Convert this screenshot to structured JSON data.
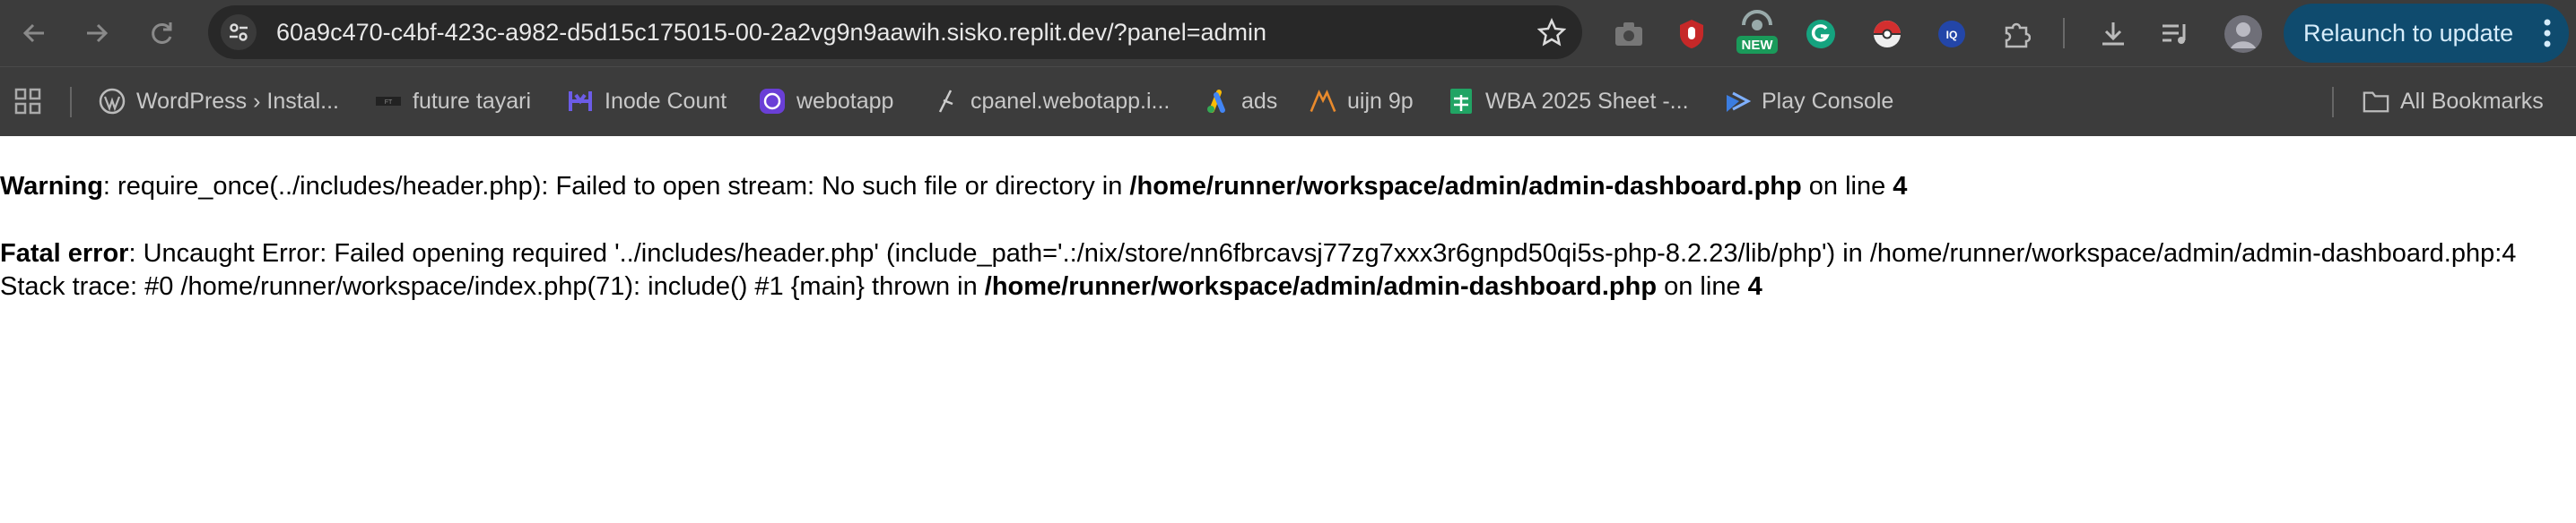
{
  "browser": {
    "url": "60a9c470-c4bf-423c-a982-d5d15c175015-00-2a2vg9n9aawih.sisko.replit.dev/?panel=admin",
    "relaunch_label": "Relaunch to update",
    "new_badge": "NEW",
    "extension_icons": [
      "camera-icon",
      "hand-stop-icon",
      "new-badge-icon",
      "grammarly-icon",
      "pokeball-icon",
      "iq-icon",
      "puzzle-icon"
    ],
    "colors": {
      "toolbar": "#3c3c3c",
      "omnibox": "#282828",
      "relaunch": "#0f4b6e"
    }
  },
  "bookmarks": [
    {
      "label": "WordPress › Instal...",
      "icon": "wordpress-icon"
    },
    {
      "label": "future tayari",
      "icon": "future-tayari-icon"
    },
    {
      "label": "Inode Count",
      "icon": "inode-icon"
    },
    {
      "label": "webotapp",
      "icon": "whatsapp-icon"
    },
    {
      "label": "cpanel.webotapp.i...",
      "icon": "cpanel-icon"
    },
    {
      "label": "ads",
      "icon": "google-ads-icon"
    },
    {
      "label": "uijn 9p",
      "icon": "uijn-icon"
    },
    {
      "label": "WBA 2025 Sheet -...",
      "icon": "sheets-icon"
    },
    {
      "label": "Play Console",
      "icon": "play-console-icon"
    }
  ],
  "all_bookmarks_label": "All Bookmarks",
  "errors": {
    "warning_label": "Warning",
    "warning_text": ": require_once(../includes/header.php): Failed to open stream: No such file or directory in ",
    "warning_path": "/home/runner/workspace/admin/admin-dashboard.php",
    "warning_online": " on line ",
    "warning_line": "4",
    "fatal_label": "Fatal error",
    "fatal_text": ": Uncaught Error: Failed opening required '../includes/header.php' (include_path='.:/nix/store/nn6fbrcavsj77zg7xxx3r6gnpd50qi5s-php-8.2.23/lib/php') in /home/runner/workspace/admin/admin-dashboard.php:4 Stack trace: #0 /home/runner/workspace/index.php(71): include() #1 {main} thrown in ",
    "fatal_path": "/home/runner/workspace/admin/admin-dashboard.php",
    "fatal_online": " on line ",
    "fatal_line": "4"
  }
}
